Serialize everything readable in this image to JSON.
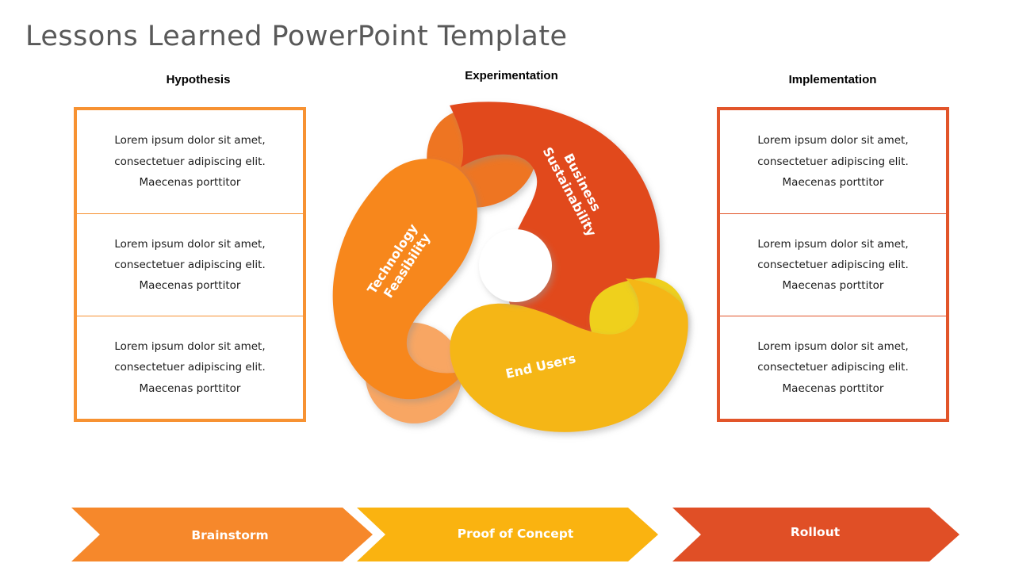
{
  "slide": {
    "title": "Lessons Learned PowerPoint Template",
    "background_color": "#FFFFFF",
    "title_color": "#595959"
  },
  "columns": {
    "left": {
      "heading": "Hypothesis",
      "border_color": "#F79232",
      "items": [
        "Lorem ipsum dolor sit amet, consectetuer adipiscing elit. Maecenas porttitor",
        "Lorem ipsum dolor sit amet, consectetuer adipiscing elit. Maecenas porttitor",
        "Lorem ipsum dolor sit amet, consectetuer adipiscing elit. Maecenas porttitor"
      ]
    },
    "center": {
      "heading": "Experimentation"
    },
    "right": {
      "heading": "Implementation",
      "border_color": "#E2552A",
      "items": [
        "Lorem ipsum dolor sit amet, consectetuer adipiscing elit. Maecenas porttitor",
        "Lorem ipsum dolor sit amet, consectetuer adipiscing elit. Maecenas porttitor",
        "Lorem ipsum dolor sit amet, consectetuer adipiscing elit. Maecenas porttitor"
      ]
    }
  },
  "pinwheel": {
    "center_circle_color": "#FFFFFF",
    "petals": [
      {
        "id": "business-sustainability",
        "label_line1": "Business",
        "label_line2": "Sustainability",
        "color": "#E1481F",
        "tail_color": "#EE7522",
        "label_font_size": 16,
        "label_rotation": 62
      },
      {
        "id": "technology-feasibility",
        "label_line1": "Technology",
        "label_line2": "Feasibility",
        "color": "#F7871F",
        "tail_color": "#F8A664",
        "label_font_size": 16,
        "label_rotation": -57
      },
      {
        "id": "end-users",
        "label_line1": "End Users",
        "label_line2": "",
        "color": "#F5B612",
        "tail_color": "#EFD01C",
        "label_font_size": 16,
        "label_rotation": -13
      }
    ]
  },
  "banner": {
    "steps": [
      {
        "label": "Brainstorm",
        "color": "#F6882B"
      },
      {
        "label": "Proof of Concept",
        "color": "#FAB310"
      },
      {
        "label": "Rollout",
        "color": "#E04F26"
      }
    ]
  }
}
